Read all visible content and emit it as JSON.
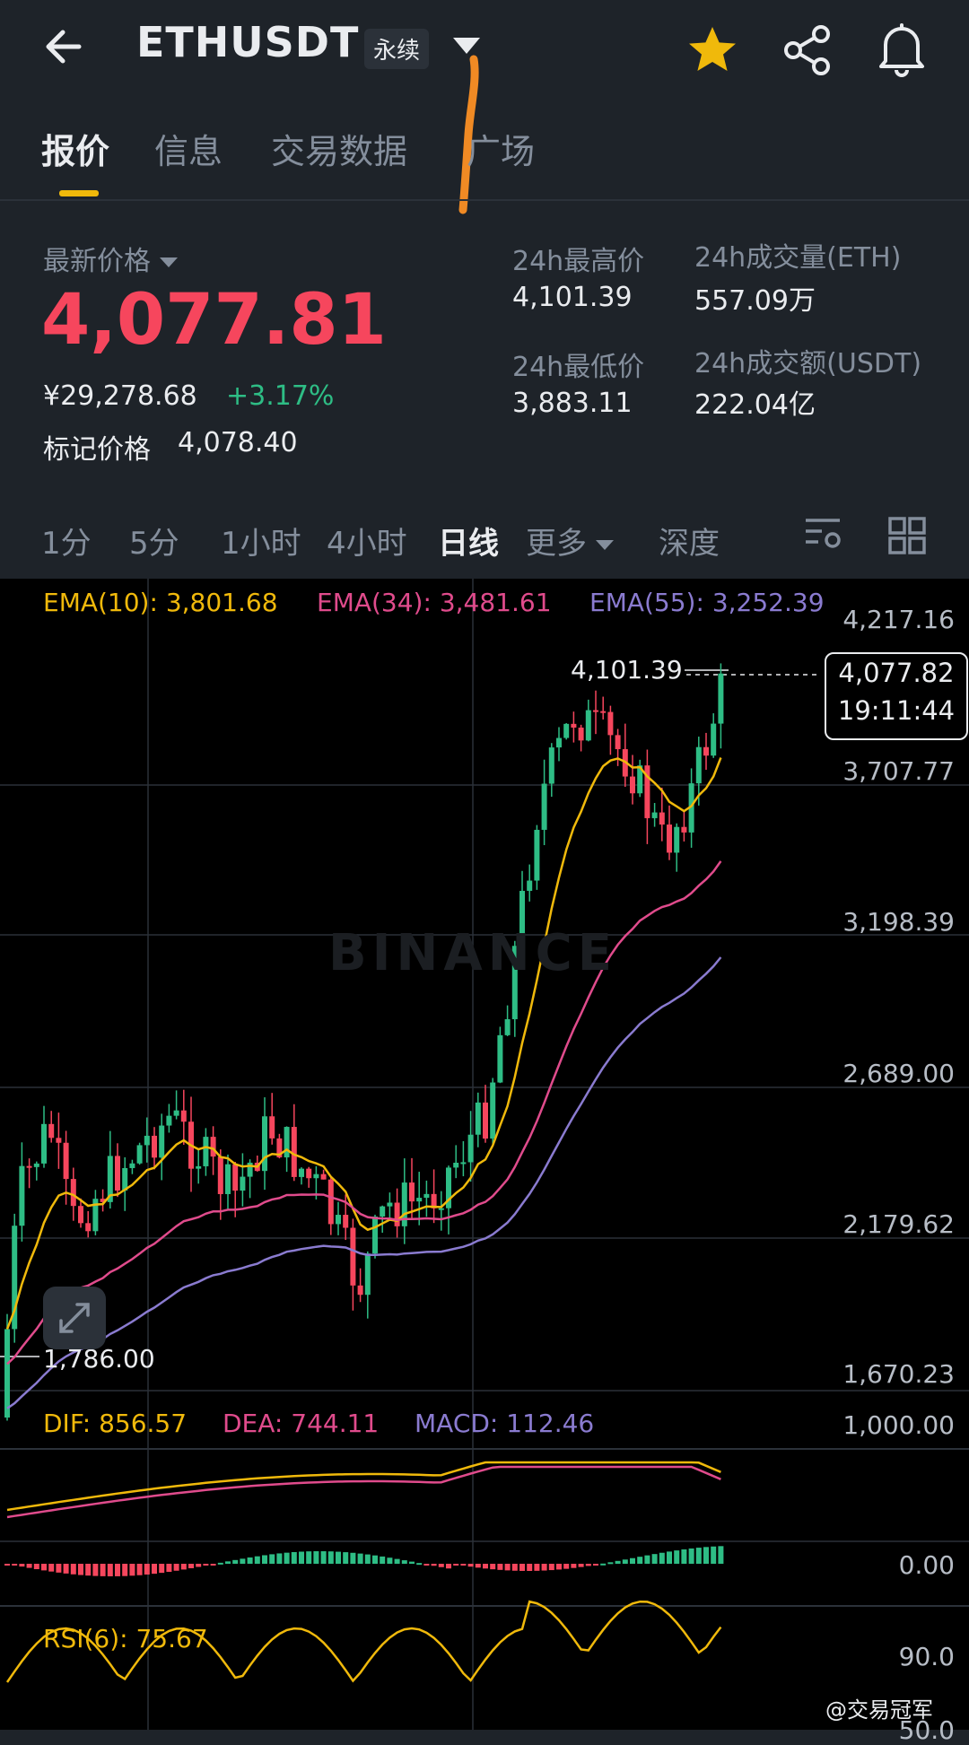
{
  "header": {
    "symbol": "ETHUSDT",
    "contract_badge": "永续"
  },
  "tabs": [
    {
      "label": "报价"
    },
    {
      "label": "信息"
    },
    {
      "label": "交易数据"
    },
    {
      "label": "广场"
    }
  ],
  "price": {
    "latest_label": "最新价格",
    "latest": "4,077.81",
    "cny": "¥29,278.68",
    "change": "+3.17%",
    "mark_label": "标记价格",
    "mark": "4,078.40",
    "high_label": "24h最高价",
    "high": "4,101.39",
    "low_label": "24h最低价",
    "low": "3,883.11",
    "vol_label": "24h成交量(ETH)",
    "vol": "557.09万",
    "amt_label": "24h成交额(USDT)",
    "amt": "222.04亿"
  },
  "intervals": [
    "1分",
    "5分",
    "1小时",
    "4小时",
    "日线",
    "更多",
    "深度"
  ],
  "chart": {
    "ema10": "EMA(10): 3,801.68",
    "ema34": "EMA(34): 3,481.61",
    "ema55": "EMA(55): 3,252.39",
    "axis": [
      "4,217.16",
      "3,707.77",
      "3,198.39",
      "2,689.00",
      "2,179.62",
      "1,670.23"
    ],
    "high_marker": "4,101.39",
    "low_marker": "1,786.00",
    "last_price": "4,077.82",
    "countdown": "19:11:44",
    "watermark": "BINANCE"
  },
  "macd": {
    "dif": "DIF: 856.57",
    "dea": "DEA: 744.11",
    "macd": "MACD: 112.46",
    "axis": [
      "1,000.00",
      "0.00"
    ]
  },
  "rsi": {
    "label": "RSI(6): 75.67",
    "axis": [
      "90.0",
      "50.0"
    ]
  },
  "footer": {
    "credit": "@交易冠军"
  },
  "colors": {
    "up": "#2ebd85",
    "down": "#f6465d",
    "ema10": "#f0b90b",
    "ema34": "#e04b8c",
    "ema55": "#8a7bd0",
    "accent": "#f0b90b"
  }
}
